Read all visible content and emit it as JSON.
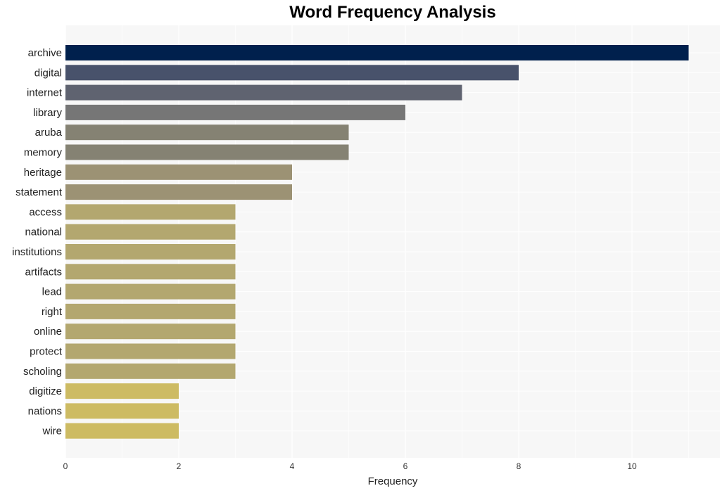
{
  "chart_data": {
    "type": "bar",
    "orientation": "horizontal",
    "title": "Word Frequency Analysis",
    "xlabel": "Frequency",
    "ylabel": "",
    "xlim": [
      0,
      11.5
    ],
    "x_ticks": [
      0,
      2,
      4,
      6,
      8,
      10
    ],
    "grid": true,
    "categories": [
      "archive",
      "digital",
      "internet",
      "library",
      "aruba",
      "memory",
      "heritage",
      "statement",
      "access",
      "national",
      "institutions",
      "artifacts",
      "lead",
      "right",
      "online",
      "protect",
      "scholing",
      "digitize",
      "nations",
      "wire"
    ],
    "values": [
      11,
      8,
      7,
      6,
      5,
      5,
      4,
      4,
      3,
      3,
      3,
      3,
      3,
      3,
      3,
      3,
      3,
      2,
      2,
      2
    ],
    "colors": [
      "#00204d",
      "#48526b",
      "#5f6370",
      "#767676",
      "#858273",
      "#858273",
      "#9c9274",
      "#9c9274",
      "#b3a76f",
      "#b3a76f",
      "#b3a76f",
      "#b3a76f",
      "#b3a76f",
      "#b3a76f",
      "#b3a76f",
      "#b3a76f",
      "#b3a76f",
      "#cdbb63",
      "#cdbb63",
      "#cdbb63"
    ],
    "plot_background": "#f7f7f7"
  }
}
